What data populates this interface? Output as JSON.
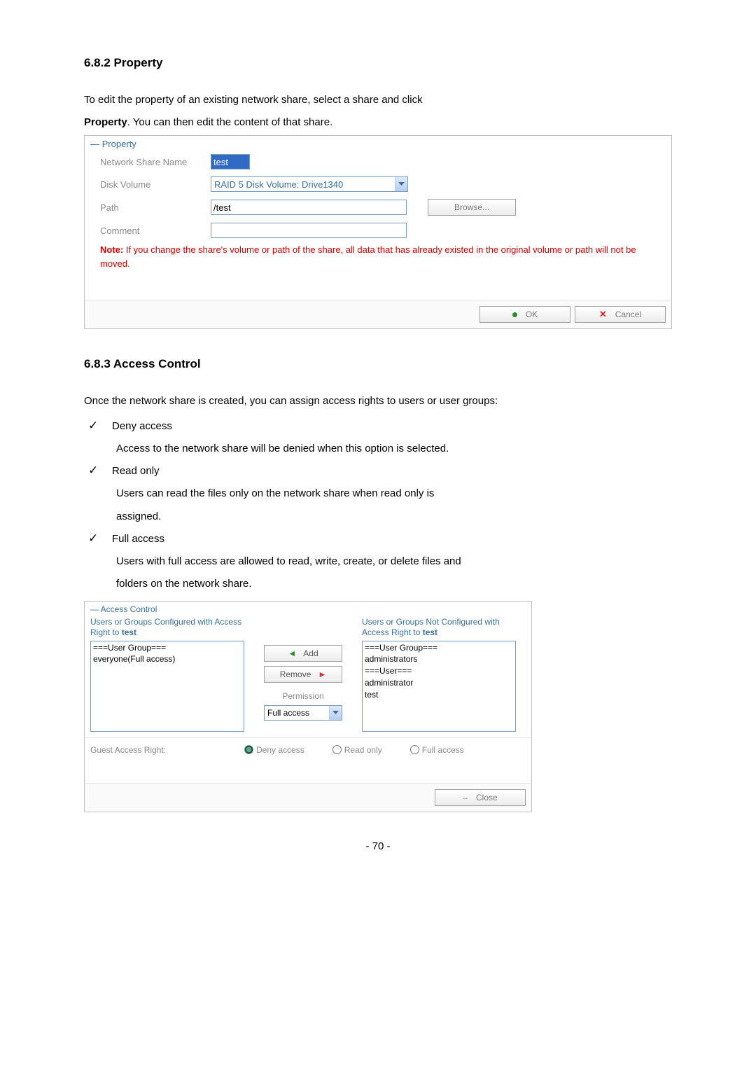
{
  "sections": {
    "property_heading": "6.8.2   Property",
    "access_heading": "6.8.3   Access Control"
  },
  "intro_property_1": "To edit the property of an existing network share, select a share and click",
  "intro_property_2a": "Property",
  "intro_property_2b": ".  You can then edit the content of that share.",
  "property_panel": {
    "title": "— Property",
    "labels": {
      "name": "Network Share Name",
      "volume": "Disk Volume",
      "path": "Path",
      "comment": "Comment"
    },
    "values": {
      "name": "test",
      "volume": "RAID 5 Disk Volume: Drive1340",
      "path": "/test",
      "comment": ""
    },
    "note_bold": "Note:",
    "note_text": " If you change the share's volume or path of the share, all data that has already existed in the original volume or path will not be moved.",
    "buttons": {
      "browse": "Browse...",
      "ok": "OK",
      "cancel": "Cancel"
    }
  },
  "intro_access": "Once the network share is created, you can assign access rights to users or user groups:",
  "checks": {
    "deny_title": "Deny access",
    "deny_desc": "Access to the network share will be denied when this option is selected.",
    "read_title": "Read only",
    "read_desc1": "Users can read the files only on the network share when read only is",
    "read_desc2": "assigned.",
    "full_title": "Full access",
    "full_desc1": "Users with full access are allowed to read, write, create, or delete files and",
    "full_desc2": "folders on the network share."
  },
  "ac_panel": {
    "title": "— Access Control",
    "left_label1": "Users or Groups Configured with Access",
    "left_label2": "Right to ",
    "left_label_bold": "test",
    "right_label1": "Users or Groups Not Configured with",
    "right_label2": "Access Right to ",
    "right_label_bold": "test",
    "left_list": [
      "===User Group===",
      "everyone(Full access)"
    ],
    "right_list": [
      "===User Group===",
      "administrators",
      "===User===",
      "administrator",
      "test"
    ],
    "buttons": {
      "add": "Add",
      "remove": "Remove",
      "close": "Close"
    },
    "permission_label": "Permission",
    "permission_value": "Full access",
    "guest_label": "Guest Access Right:",
    "radios": {
      "deny": "Deny access",
      "read": "Read only",
      "full": "Full access"
    }
  },
  "page_number": "- 70 -"
}
